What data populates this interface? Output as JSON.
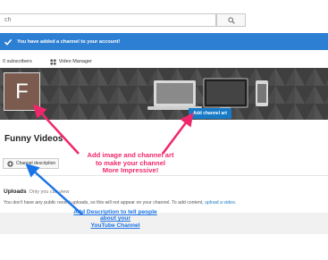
{
  "search": {
    "placeholder": "ch",
    "button_icon": "search-icon"
  },
  "notice": {
    "text": "You have added a channel to your account!",
    "icon": "check-icon",
    "color": "#2d7fd3"
  },
  "stats": {
    "subscribers": "0 subscribers",
    "video_manager": "Video Manager"
  },
  "channel": {
    "avatar_letter": "F",
    "name": "Funny Videos",
    "add_art_label": "Add channel art",
    "description_button": "Channel description"
  },
  "uploads": {
    "heading": "Uploads",
    "subheading": "Only you can view",
    "text_before": "You don't have any public recent uploads, so this will not appear on your channel. To add content, ",
    "link": "upload a video",
    "text_after": "."
  },
  "annotations": {
    "red": [
      "Add image and channel art",
      "to make your channel",
      "More Impressive!"
    ],
    "blue": [
      "Add Description to tell people",
      "about your",
      "YouTube Channel"
    ],
    "red_color": "#f0266b",
    "blue_color": "#1a73e8"
  }
}
